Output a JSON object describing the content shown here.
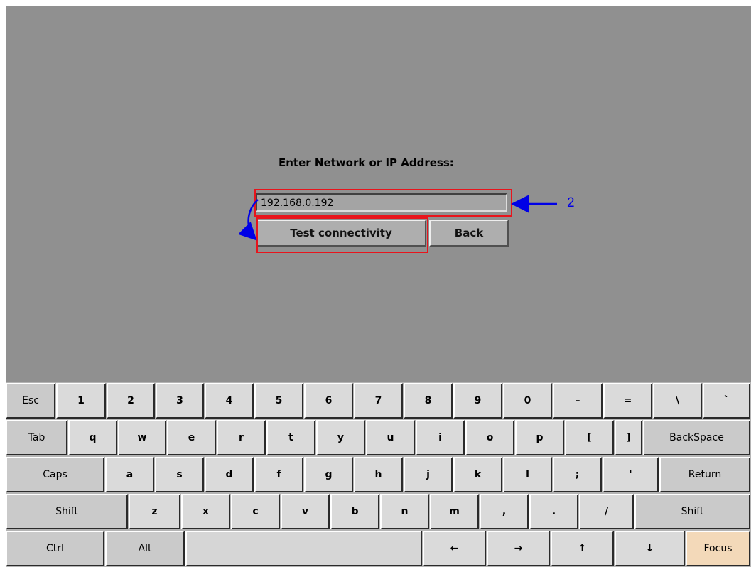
{
  "dialog": {
    "prompt": "Enter Network or IP Address:",
    "ip_value": "192.168.0.192",
    "test_button": "Test connectivity",
    "back_button": "Back"
  },
  "annotation": {
    "number": "2",
    "highlight_color": "#e8141c",
    "arrow_color": "#0000e6"
  },
  "keyboard": {
    "row1": [
      "Esc",
      "1",
      "2",
      "3",
      "4",
      "5",
      "6",
      "7",
      "8",
      "9",
      "0",
      "–",
      "=",
      "\\",
      "`"
    ],
    "row2": [
      "Tab",
      "q",
      "w",
      "e",
      "r",
      "t",
      "y",
      "u",
      "i",
      "o",
      "p",
      "[",
      "]",
      "BackSpace"
    ],
    "row3": [
      "Caps",
      "a",
      "s",
      "d",
      "f",
      "g",
      "h",
      "j",
      "k",
      "l",
      ";",
      "'",
      "Return"
    ],
    "row4": [
      "Shift",
      "z",
      "x",
      "c",
      "v",
      "b",
      "n",
      "m",
      ",",
      ".",
      "/",
      "Shift"
    ],
    "row5": [
      "Ctrl",
      "Alt",
      "",
      "←",
      "→",
      "↑",
      "↓",
      "Focus"
    ],
    "focus_key_color": "#f3d9b9"
  }
}
